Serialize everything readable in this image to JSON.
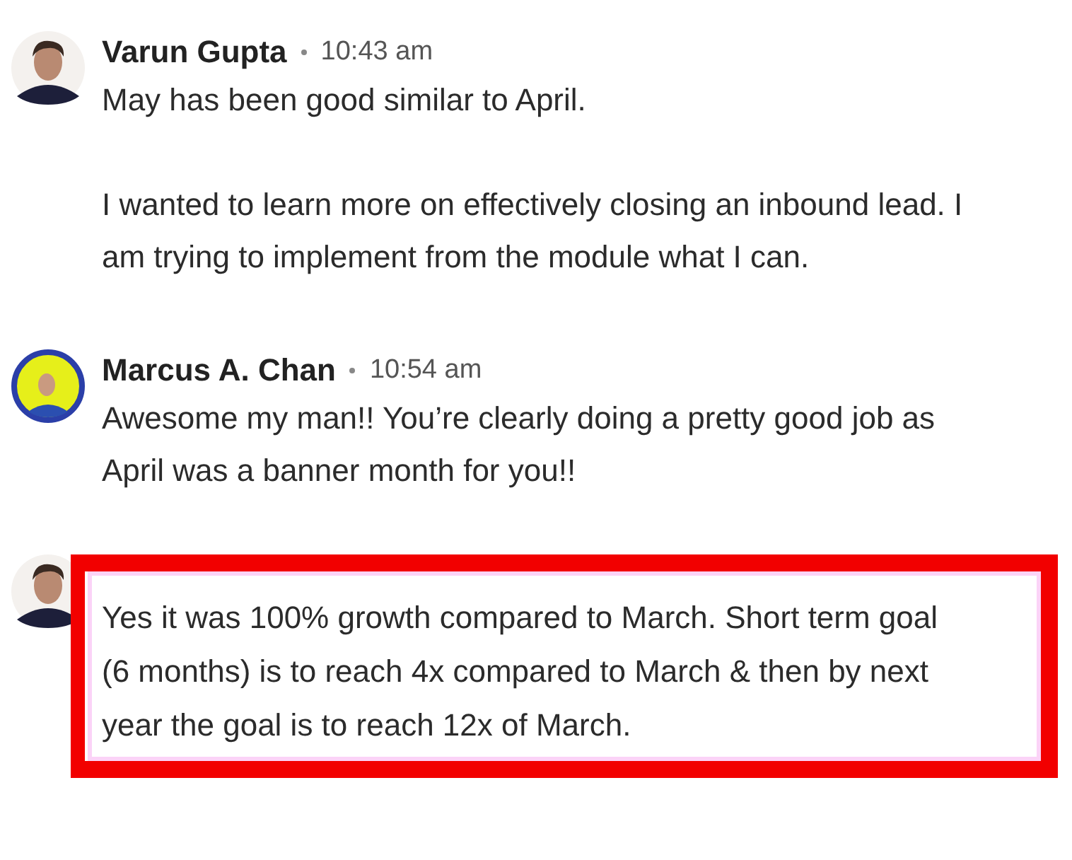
{
  "messages": [
    {
      "author": "Varun Gupta",
      "time": "10:43 am",
      "avatar": {
        "kind": "plain"
      },
      "highlighted": false,
      "paragraphs": [
        "May has been good similar to April.",
        "I wanted to learn more on effectively closing an inbound lead. I am trying to implement from the module what I can."
      ]
    },
    {
      "author": "Marcus A. Chan",
      "time": "10:54 am",
      "avatar": {
        "kind": "ringed"
      },
      "highlighted": false,
      "paragraphs": [
        "Awesome my man!! You’re clearly doing a pretty good job as April was a banner month for you!!"
      ]
    },
    {
      "avatar": {
        "kind": "plain"
      },
      "highlighted": true,
      "paragraphs": [
        "Yes it was 100% growth compared to March. Short term goal (6 months) is to reach 4x compared to March & then by next year the goal is to reach 12x of March."
      ]
    }
  ]
}
